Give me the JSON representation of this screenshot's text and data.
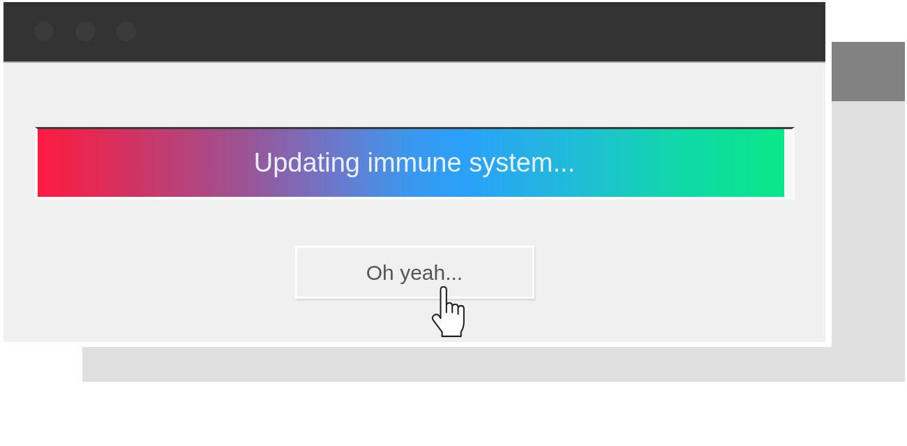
{
  "dialog": {
    "window_controls": [
      {
        "kind": "dot"
      },
      {
        "kind": "dot"
      },
      {
        "kind": "dot"
      }
    ],
    "progress": {
      "label": "Updating immune system...",
      "level": 0.99
    },
    "buttons": [
      {
        "label": "Oh yeah..."
      }
    ]
  }
}
